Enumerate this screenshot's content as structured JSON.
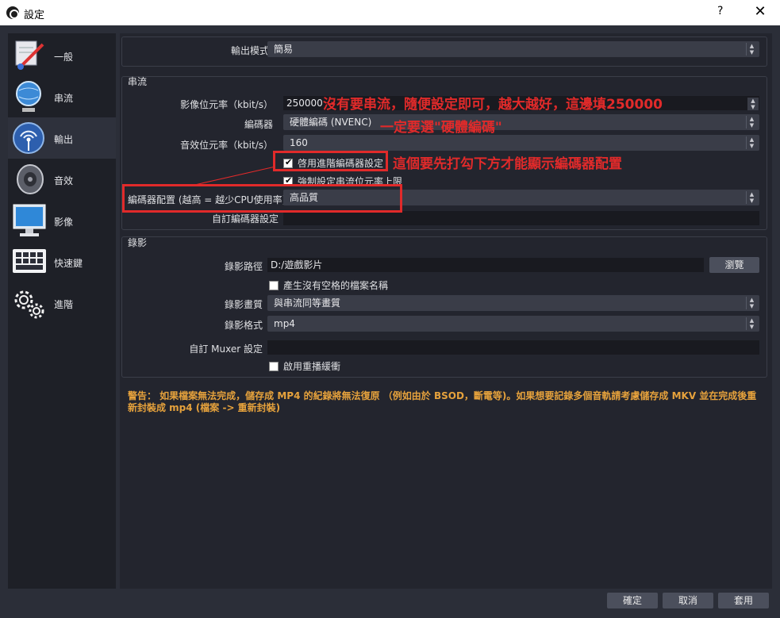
{
  "window": {
    "title": "設定",
    "help_label": "?",
    "close_label": "✕"
  },
  "sidebar": {
    "items": [
      {
        "label": "一般",
        "icon": "general-icon"
      },
      {
        "label": "串流",
        "icon": "globe-stream-icon"
      },
      {
        "label": "輸出",
        "icon": "broadcast-output-icon"
      },
      {
        "label": "音效",
        "icon": "speaker-icon"
      },
      {
        "label": "影像",
        "icon": "monitor-icon"
      },
      {
        "label": "快速鍵",
        "icon": "keyboard-icon"
      },
      {
        "label": "進階",
        "icon": "gears-icon"
      }
    ],
    "active_index": 2
  },
  "output_mode": {
    "label": "輸出模式",
    "value": "簡易"
  },
  "streaming": {
    "title": "串流",
    "video_bitrate_label": "影像位元率（kbit/s）",
    "video_bitrate_value": "250000",
    "encoder_label": "編碼器",
    "encoder_value": "硬體編碼 (NVENC)",
    "audio_bitrate_label": "音效位元率（kbit/s）",
    "audio_bitrate_value": "160",
    "advanced_encoder_label": "啓用進階編碼器設定",
    "enforce_limit_label": "強制設定串流位元率上限",
    "preset_label": "編碼器配置 (越高 = 越少CPU使用率)",
    "preset_value": "高品質",
    "custom_encoder_label": "自訂編碼器設定",
    "custom_encoder_value": ""
  },
  "recording": {
    "title": "錄影",
    "path_label": "錄影路徑",
    "path_value": "D:/遊戲影片",
    "browse_label": "瀏覽",
    "no_space_label": "產生沒有空格的檔案名稱",
    "quality_label": "錄影畫質",
    "quality_value": "與串流同等畫質",
    "format_label": "錄影格式",
    "format_value": "mp4",
    "muxer_label": "自訂 Muxer 設定",
    "muxer_value": "",
    "replay_buffer_label": "啟用重播緩衝"
  },
  "warning": "警告： 如果檔案無法完成，儲存成 MP4 的紀錄將無法復原 （例如由於 BSOD，斷電等)。如果想要記錄多個音軌請考慮儲存成 MKV 並在完成後重新封裝成 mp4 (檔案 -> 重新封裝)",
  "footer": {
    "ok_label": "確定",
    "cancel_label": "取消",
    "apply_label": "套用"
  },
  "annotations": {
    "bitrate_note": "沒有要串流，隨便設定即可，越大越好，這邊填250000",
    "encoder_note": "一定要選\"硬體編碼\"",
    "checkbox_note": "這個要先打勾下方才能顯示編碼器配置"
  },
  "colors": {
    "annotation": "#e12a2a",
    "warning": "#e6a23c",
    "background": "#2b2e38"
  }
}
